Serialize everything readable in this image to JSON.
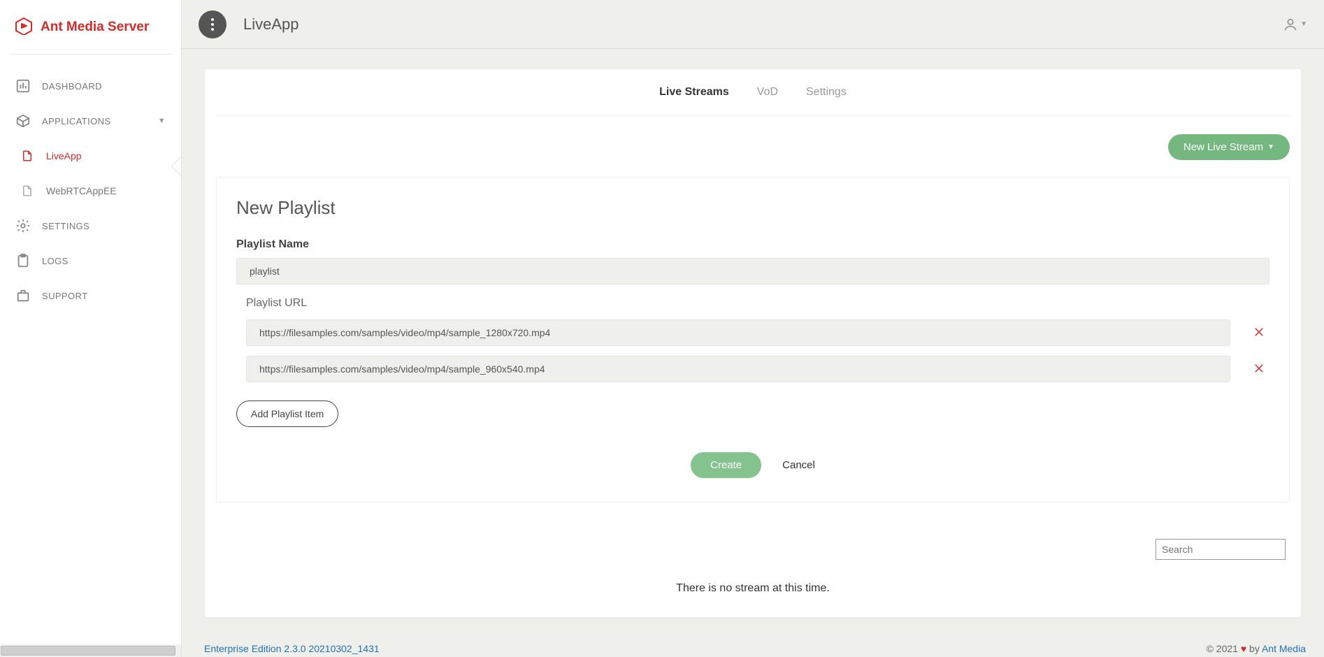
{
  "brand": {
    "name": "Ant Media Server"
  },
  "sidebar": {
    "dashboard": "Dashboard",
    "applications": "Applications",
    "apps": [
      {
        "label": "LiveApp",
        "active": true
      },
      {
        "label": "WebRTCAppEE",
        "active": false
      }
    ],
    "settings": "Settings",
    "logs": "Logs",
    "support": "Support"
  },
  "header": {
    "title": "LiveApp"
  },
  "tabs": {
    "live": "Live Streams",
    "vod": "VoD",
    "settings": "Settings"
  },
  "actions": {
    "new_live_stream": "New Live Stream"
  },
  "form": {
    "title": "New Playlist",
    "name_label": "Playlist Name",
    "name_value": "playlist",
    "url_label": "Playlist URL",
    "urls": [
      "https://filesamples.com/samples/video/mp4/sample_1280x720.mp4",
      "https://filesamples.com/samples/video/mp4/sample_960x540.mp4"
    ],
    "add_item": "Add Playlist Item",
    "create": "Create",
    "cancel": "Cancel"
  },
  "search": {
    "placeholder": "Search"
  },
  "empty": "There is no stream at this time.",
  "footer": {
    "version": "Enterprise Edition 2.3.0 20210302_1431",
    "copyright": "© 2021 ",
    "by": " by ",
    "company": "Ant Media"
  },
  "colors": {
    "brand": "#d02c2c",
    "accent": "#75b87f"
  }
}
